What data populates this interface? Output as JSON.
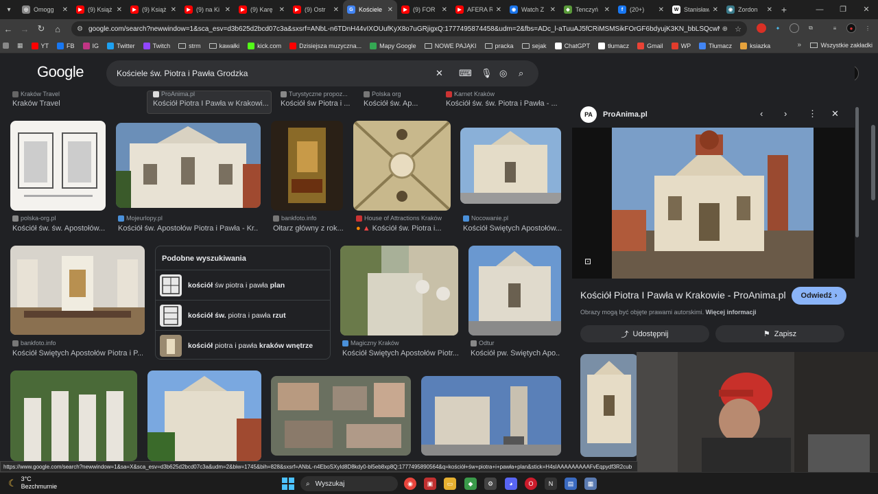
{
  "tabs": [
    {
      "label": "Omogg",
      "color": "#888888",
      "glyph": "◎",
      "active": false
    },
    {
      "label": "(9) Książ",
      "color": "#ff0000",
      "glyph": "▶",
      "active": false
    },
    {
      "label": "(9) Książ",
      "color": "#ff0000",
      "glyph": "▶",
      "active": false
    },
    {
      "label": "(9) na Ki",
      "color": "#ff0000",
      "glyph": "▶",
      "active": false
    },
    {
      "label": "(9) Karę",
      "color": "#ff0000",
      "glyph": "▶",
      "active": false
    },
    {
      "label": "(9) Ostr",
      "color": "#ff0000",
      "glyph": "▶",
      "active": false
    },
    {
      "label": "Kościele",
      "color": "#4285f4",
      "glyph": "G",
      "active": true
    },
    {
      "label": "(9) FOR",
      "color": "#ff0000",
      "glyph": "▶",
      "active": false
    },
    {
      "label": "AFERA R",
      "color": "#ff0000",
      "glyph": "▶",
      "active": false
    },
    {
      "label": "Watch Z",
      "color": "#1a73e8",
      "glyph": "◉",
      "active": false
    },
    {
      "label": "Tenczyń",
      "color": "#5a9a3a",
      "glyph": "◆",
      "active": false
    },
    {
      "label": "(20+)",
      "color": "#1877f2",
      "glyph": "f",
      "active": false
    },
    {
      "label": "Stanisław",
      "color": "#ffffff",
      "glyph": "W",
      "active": false
    },
    {
      "label": "Zordon",
      "color": "#3a7a8a",
      "glyph": "◉",
      "active": false
    }
  ],
  "toolbar": {
    "url": "google.com/search?newwindow=1&sca_esv=d3b625d2bcd07c3a&sxsrf=ANbL-n6TDnH44vIXOUufKyX8o7uGRjigxQ:1777495874458&udm=2&fbs=ADc_l-aTuuAJ5fCRiMSMSikFOrGF6bdyujK3KN_bbLSQcwMisxdiif74vgJz9..."
  },
  "bookmarks": [
    {
      "label": "YT",
      "color": "#ff0000"
    },
    {
      "label": "FB",
      "color": "#1877f2"
    },
    {
      "label": "IG",
      "color": "#c13584"
    },
    {
      "label": "Twitter",
      "color": "#1da1f2"
    },
    {
      "label": "Twitch",
      "color": "#9146ff"
    },
    {
      "label": "strm",
      "color": "folder"
    },
    {
      "label": "kawałki",
      "color": "folder"
    },
    {
      "label": "kick.com",
      "color": "#53fc18"
    },
    {
      "label": "Dzisiejsza muzyczna...",
      "color": "#ff0000"
    },
    {
      "label": "Mapy Google",
      "color": "#34a853"
    },
    {
      "label": "NOWE PAJĄKI",
      "color": "folder"
    },
    {
      "label": "pracka",
      "color": "folder"
    },
    {
      "label": "sejak",
      "color": "folder"
    },
    {
      "label": "ChatGPT",
      "color": "#ffffff"
    },
    {
      "label": "tłumacz",
      "color": "#ffffff"
    },
    {
      "label": "Gmail",
      "color": "#ea4335"
    },
    {
      "label": "WP",
      "color": "#e23c2c"
    },
    {
      "label": "Tłumacz",
      "color": "#4285f4"
    },
    {
      "label": "ksiazka",
      "color": "#e6a23c"
    }
  ],
  "bookmarks_all": "Wszystkie zakładki",
  "google_logo": "Google",
  "search": {
    "query": "Kościele św. Piotra i Pawła Grodzka"
  },
  "top_row": [
    {
      "source": "Kraków Travel",
      "title": "Kraków Travel"
    },
    {
      "source": "ProAnima.pl",
      "title": "Kościół Piotra I Pawła w Krakowi..."
    },
    {
      "source": "Turystyczne propoz...",
      "title": "Kościół św Piotra i ..."
    },
    {
      "source": "Polska org",
      "title": "Kościół św. Ap..."
    },
    {
      "source": "Karnet Kraków",
      "title": "Kościół św. św. Piotra i Pawła - ..."
    }
  ],
  "row1": [
    {
      "source": "polska-org.pl",
      "title": "Kościół św. św. Apostołów..."
    },
    {
      "source": "Mojeurlopy.pl",
      "title": "Kościół św. Apostołów Piotra i Pawła - Kr..."
    },
    {
      "source": "bankfoto.info",
      "title": "Ołtarz główny z rok..."
    },
    {
      "source": "House of Attractions Kraków",
      "title": "Kościół św. Piotra i..."
    },
    {
      "source": "Nocowanie.pl",
      "title": "Kościół Świętych Apostołów..."
    }
  ],
  "row2": [
    {
      "source": "bankfoto.info",
      "title": "Kościół Świętych Apostołów Piotra i P..."
    },
    {
      "source": "Magiczny Kraków",
      "title": "Kościół Świętych Apostołów Piotr..."
    },
    {
      "source": "Odtur",
      "title": "Kościół pw. Świętych Apo..."
    }
  ],
  "related": {
    "heading": "Podobne wyszukiwania",
    "items": [
      {
        "bold1": "kościół",
        "mid": " św piotra i pawła ",
        "bold2": "plan"
      },
      {
        "bold1": "kościół św.",
        "mid": " piotra i pawła ",
        "bold2": "rzut"
      },
      {
        "bold1": "kościół",
        "mid": " piotra i pawła ",
        "bold2": "kraków wnętrze"
      }
    ]
  },
  "panel": {
    "source": "ProAnima.pl",
    "logo": "PA",
    "title": "Kościół Piotra I Pawła w Krakowie - ProAnima.pl",
    "visit": "Odwiedź",
    "note": "Obrazy mogą być objęte prawami autorskimi.",
    "note_link": "Więcej informacji",
    "share": "Udostępnij",
    "save": "Zapisz"
  },
  "status_url": "https://www.google.com/search?newwindow=1&sa=X&sca_esv=d3b625d2bcd07c3a&udm=2&biw=1745&bih=828&sxsrf=ANbL-n4EboSXyId8D8kdy0-bl5eb8xp8Q:1777495890564&q=kościół+św+piotra+i+pawła+plan&stick=H4sIAAAAAAAAAFvEqpydf3R2cub",
  "taskbar": {
    "temp": "3°C",
    "weather": "Bezchmurnie",
    "search": "Wyszukaj"
  }
}
